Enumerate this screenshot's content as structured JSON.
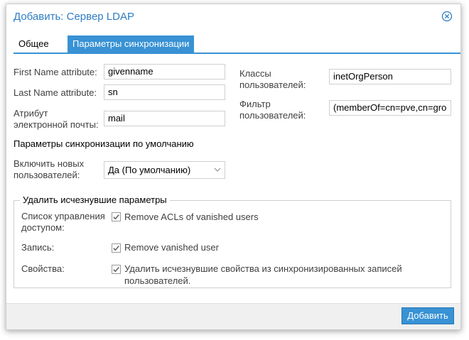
{
  "dialog": {
    "title": "Добавить: Сервер LDAP"
  },
  "tabs": [
    {
      "label": "Общее",
      "active": false
    },
    {
      "label": "Параметры синхронизации",
      "active": true
    }
  ],
  "fields": {
    "first_name": {
      "label": "First Name attribute:",
      "value": "givenname"
    },
    "last_name": {
      "label": "Last Name attribute:",
      "value": "sn"
    },
    "email": {
      "label_line1": "Атрибут",
      "label_line2": "электронной почты:",
      "value": "mail"
    },
    "user_classes": {
      "label_line1": "Классы",
      "label_line2": "пользователей:",
      "value": "inetOrgPerson"
    },
    "user_filter": {
      "label_line1": "Фильтр",
      "label_line2": "пользователей:",
      "value": "(memberOf=cn=pve,cn=gro"
    }
  },
  "defaults": {
    "section_title": "Параметры синхронизации по умолчанию",
    "enable_new": {
      "label_line1": "Включить новых",
      "label_line2": "пользователей:",
      "value": "Да (По умолчанию)"
    }
  },
  "vanished": {
    "legend": "Удалить исчезнувшие параметры",
    "acl": {
      "label_line1": "Список управления",
      "label_line2": "доступом:",
      "checkbox": "Remove ACLs of vanished users",
      "checked": true
    },
    "entry": {
      "label": "Запись:",
      "checkbox": "Remove vanished user",
      "checked": true
    },
    "properties": {
      "label": "Свойства:",
      "checkbox_line1": "Удалить исчезнувшие свойства из синхронизированных записей",
      "checkbox_line2": "пользователей.",
      "checked": true
    }
  },
  "footer": {
    "add_label": "Добавить"
  },
  "colors": {
    "accent": "#3892d4",
    "title": "#2d7dc4"
  }
}
